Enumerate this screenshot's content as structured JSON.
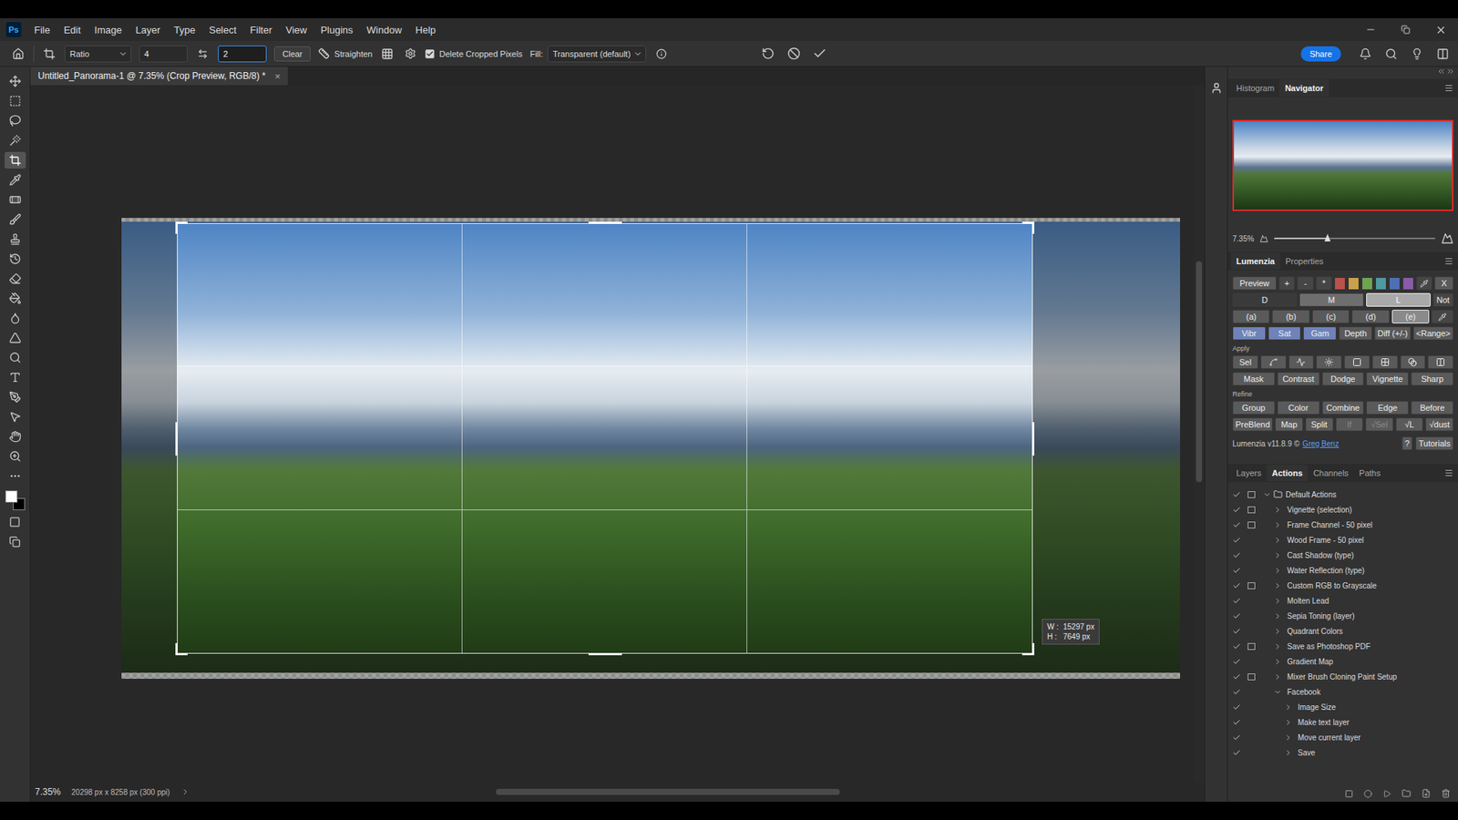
{
  "app": {
    "logo": "Ps"
  },
  "menu": [
    "File",
    "Edit",
    "Image",
    "Layer",
    "Type",
    "Select",
    "Filter",
    "View",
    "Plugins",
    "Window",
    "Help"
  ],
  "options_bar": {
    "preset": "Ratio",
    "width": "4",
    "height_field": {
      "value": "2",
      "focused": true
    },
    "clear": "Clear",
    "straighten": "Straighten",
    "delete_cropped": {
      "label": "Delete Cropped Pixels",
      "checked": true
    },
    "fill_label": "Fill:",
    "fill_value": "Transparent (default)",
    "share": "Share"
  },
  "document_tab": {
    "title": "Untitled_Panorama-1 @ 7.35% (Crop Preview, RGB/8) *",
    "close": "×"
  },
  "tools": [
    {
      "selected": false
    },
    {
      "selected": false
    },
    {
      "selected": false
    },
    {
      "selected": false
    },
    {
      "selected": true
    },
    {
      "selected": false
    },
    {
      "selected": false
    },
    {
      "selected": false
    },
    {
      "selected": false
    },
    {
      "selected": false
    },
    {
      "selected": false
    },
    {
      "selected": false
    },
    {
      "selected": false
    },
    {
      "selected": false
    },
    {
      "selected": false
    },
    {
      "selected": false
    },
    {
      "selected": false
    },
    {
      "selected": false
    },
    {
      "selected": false
    },
    {
      "selected": false
    },
    {
      "selected": false
    }
  ],
  "crop": {
    "w_label": "W :",
    "w_value": "15297 px",
    "h_label": "H :",
    "h_value": "7649 px"
  },
  "status_bar": {
    "zoom": "7.35%",
    "info": "20298 px x 8258 px (300 ppi)"
  },
  "navigator": {
    "tabs": [
      {
        "label": "Histogram",
        "selected": false
      },
      {
        "label": "Navigator",
        "selected": true
      }
    ],
    "zoom": "7.35%",
    "level": 0.33
  },
  "lumenzia": {
    "tabs": [
      {
        "label": "Lumenzia",
        "selected": true
      },
      {
        "label": "Properties",
        "selected": false
      }
    ],
    "preview": "Preview",
    "ops": [
      "+",
      "-",
      "*"
    ],
    "swatches": [
      {
        "color": "#b8524a"
      },
      {
        "color": "#c9a14c"
      },
      {
        "color": "#6ea551"
      },
      {
        "color": "#4f9aa0"
      },
      {
        "color": "#4f6fb5"
      },
      {
        "color": "#8a5ba8"
      }
    ],
    "close": "X",
    "zones": [
      {
        "label": "D",
        "selected": false
      },
      {
        "label": "M",
        "selected": false
      },
      {
        "label": "L",
        "selected": true
      }
    ],
    "not": "Not",
    "letters": [
      {
        "label": "(a)",
        "selected": false
      },
      {
        "label": "(b)",
        "selected": false
      },
      {
        "label": "(c)",
        "selected": false
      },
      {
        "label": "(d)",
        "selected": false
      },
      {
        "label": "(e)",
        "selected": true
      }
    ],
    "modes": [
      {
        "label": "Vibr",
        "active": true
      },
      {
        "label": "Sat",
        "active": true
      },
      {
        "label": "Gam",
        "active": true
      },
      {
        "label": "Depth",
        "active": false
      },
      {
        "label": "Diff (+/-)",
        "active": false
      },
      {
        "label": "<Range>",
        "active": false
      }
    ],
    "apply_label": "Apply",
    "sel": "Sel",
    "apply_buttons": [
      "Mask",
      "Contrast",
      "Dodge",
      "Vignette",
      "Sharp"
    ],
    "refine_label": "Refine",
    "refine_row1": [
      "Group",
      "Color",
      "Combine",
      "Edge",
      "Before"
    ],
    "refine_row2": [
      {
        "label": "PreBlend",
        "disabled": false
      },
      {
        "label": "Map",
        "disabled": false
      },
      {
        "label": "Split",
        "disabled": false
      },
      {
        "label": "If",
        "disabled": true
      },
      {
        "label": "√Sel",
        "disabled": true
      },
      {
        "label": "√L",
        "disabled": false
      },
      {
        "label": "√dust",
        "disabled": false
      }
    ],
    "footer": {
      "version": "Lumenzia v11.8.9 ©",
      "author": "Greg Benz",
      "help": "?",
      "tutorials": "Tutorials"
    }
  },
  "actions_panel": {
    "tabs": [
      {
        "label": "Layers",
        "selected": false
      },
      {
        "label": "Actions",
        "selected": true
      },
      {
        "label": "Channels",
        "selected": false
      },
      {
        "label": "Paths",
        "selected": false
      }
    ],
    "rows": [
      {
        "name": "Default Actions",
        "kind": "set",
        "depth": 0,
        "enabled": true,
        "dialog": true,
        "expanded": true
      },
      {
        "name": "Vignette (selection)",
        "kind": "action",
        "depth": 1,
        "enabled": true,
        "dialog": true,
        "expanded": false
      },
      {
        "name": "Frame Channel - 50 pixel",
        "kind": "action",
        "depth": 1,
        "enabled": true,
        "dialog": true,
        "expanded": false
      },
      {
        "name": "Wood Frame - 50 pixel",
        "kind": "action",
        "depth": 1,
        "enabled": true,
        "dialog": false,
        "expanded": false
      },
      {
        "name": "Cast Shadow (type)",
        "kind": "action",
        "depth": 1,
        "enabled": true,
        "dialog": false,
        "expanded": false
      },
      {
        "name": "Water Reflection (type)",
        "kind": "action",
        "depth": 1,
        "enabled": true,
        "dialog": false,
        "expanded": false
      },
      {
        "name": "Custom RGB to Grayscale",
        "kind": "action",
        "depth": 1,
        "enabled": true,
        "dialog": true,
        "expanded": false
      },
      {
        "name": "Molten Lead",
        "kind": "action",
        "depth": 1,
        "enabled": true,
        "dialog": false,
        "expanded": false
      },
      {
        "name": "Sepia Toning (layer)",
        "kind": "action",
        "depth": 1,
        "enabled": true,
        "dialog": false,
        "expanded": false
      },
      {
        "name": "Quadrant Colors",
        "kind": "action",
        "depth": 1,
        "enabled": true,
        "dialog": false,
        "expanded": false
      },
      {
        "name": "Save as Photoshop PDF",
        "kind": "action",
        "depth": 1,
        "enabled": true,
        "dialog": true,
        "expanded": false
      },
      {
        "name": "Gradient Map",
        "kind": "action",
        "depth": 1,
        "enabled": true,
        "dialog": false,
        "expanded": false
      },
      {
        "name": "Mixer Brush Cloning Paint Setup",
        "kind": "action",
        "depth": 1,
        "enabled": true,
        "dialog": true,
        "expanded": false
      },
      {
        "name": "Facebook",
        "kind": "action",
        "depth": 1,
        "enabled": true,
        "dialog": false,
        "expanded": true
      },
      {
        "name": "Image Size",
        "kind": "step",
        "depth": 2,
        "enabled": true,
        "dialog": false,
        "expanded": false
      },
      {
        "name": "Make text layer",
        "kind": "step",
        "depth": 2,
        "enabled": true,
        "dialog": false,
        "expanded": false
      },
      {
        "name": "Move current layer",
        "kind": "step",
        "depth": 2,
        "enabled": true,
        "dialog": false,
        "expanded": false
      },
      {
        "name": "Save",
        "kind": "step",
        "depth": 2,
        "enabled": true,
        "dialog": false,
        "expanded": false
      }
    ]
  }
}
